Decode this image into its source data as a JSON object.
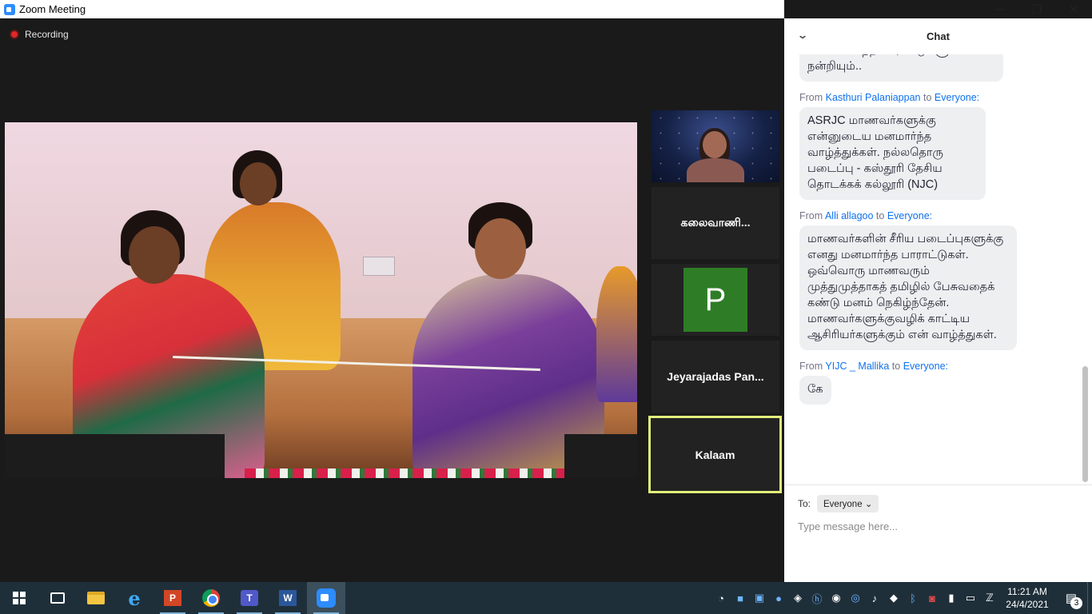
{
  "window": {
    "title": "Zoom Meeting",
    "minimize_icon": "—",
    "restore_icon": "❐",
    "close_icon": "✕"
  },
  "meeting": {
    "recording_label": "Recording"
  },
  "participants": [
    {
      "type": "video",
      "name": ""
    },
    {
      "type": "name",
      "name": "கலைவாணி..."
    },
    {
      "type": "avatar",
      "name": "",
      "initial": "P",
      "avatar_color": "#2e7d26"
    },
    {
      "type": "name",
      "name": "Jeyarajadas  Pan..."
    },
    {
      "type": "name",
      "name": "Kalaam",
      "active_speaker": true,
      "highlight_color": "#e2ef7a"
    }
  ],
  "chat": {
    "title": "Chat",
    "collapse_icon": "chevron-down-icon",
    "messages": [
      {
        "sender": "",
        "recipient": "",
        "text": "... மனமார்ந்த பாராட்டுகளும் நன்றியும்..",
        "partial": true
      },
      {
        "sender": "Kasthuri Palaniappan",
        "recipient": "Everyone:",
        "text": "ASRJC மாணவர்களுக்கு என்னுடைய மனமார்ந்த வாழ்த்துக்கள். நல்லதொரு படைப்பு - கஸ்தூரி தேசிய தொடக்கக் கல்லூரி (NJC)"
      },
      {
        "sender": "Alli allagoo",
        "recipient": "Everyone:",
        "text": "மாணவர்களின் சீரிய படைப்புகளுக்கு எனது மனமார்ந்த பாராட்டுகள். ஒவ்வொரு மாணவரும் முத்துமுத்தாகத் தமிழில் பேசுவதைக் கண்டு மனம் நெகிழ்ந்தேன். மாணவர்களுக்குவழிக் காட்டிய ஆசிரியர்களுக்கும் என் வாழ்த்துகள்."
      },
      {
        "sender": "YIJC _ Mallika",
        "recipient": "Everyone:",
        "text": "கே"
      }
    ],
    "from_label": "From",
    "to_word": "to",
    "to_label": "To:",
    "to_value": "Everyone",
    "input_placeholder": "Type message here..."
  },
  "taskbar": {
    "apps": [
      "windows-start",
      "task-view",
      "file-explorer",
      "internet-explorer",
      "powerpoint",
      "chrome",
      "teams",
      "word",
      "zoom"
    ],
    "ppt_letter": "P",
    "teams_letter": "T",
    "word_letter": "W",
    "ie_letter": "e",
    "time": "11:21 AM",
    "date": "24/4/2021",
    "notification_count": "3",
    "accent_color": "#2d8cff"
  }
}
